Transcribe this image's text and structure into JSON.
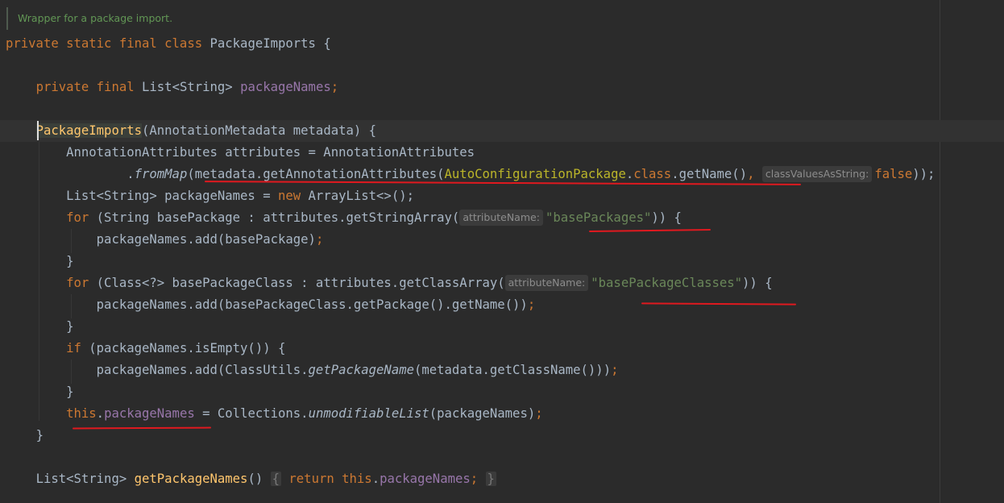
{
  "doc_comment": "Wrapper for a package import.",
  "code": {
    "class_decl": {
      "kw": "private static final class",
      "name": "PackageImports",
      "open": " {"
    },
    "field_decl": {
      "kw": "private final",
      "type": " List<String> ",
      "name": "packageNames",
      "end": ";"
    },
    "ctor": {
      "name": "PackageImports",
      "params": "(AnnotationMetadata metadata) {"
    },
    "l_attrs": "AnnotationAttributes attributes = AnnotationAttributes",
    "l_frommap": {
      "dot": ".",
      "method": "fromMap",
      "pre": "(metadata.getAnnotationAttributes(",
      "annotation": "AutoConfigurationPackage",
      "dot2": ".",
      "class_kw": "class",
      "post": ".getName()",
      "comma": ",",
      "hint": "classValuesAsString:",
      "value": "false",
      "end": "));"
    },
    "l_list": {
      "pre": "List<String> packageNames = ",
      "new_kw": "new",
      "post": " ArrayList<>();"
    },
    "l_for1": {
      "kw": "for",
      "pre": " (String basePackage : attributes.getStringArray(",
      "hint": "attributeName:",
      "str": "\"basePackages\"",
      "end": ")) {"
    },
    "l_add1": {
      "text": "packageNames.add(basePackage)",
      "end": ";"
    },
    "brace": "}",
    "l_for2": {
      "kw": "for",
      "pre": " (Class<?> basePackageClass : attributes.getClassArray(",
      "hint": "attributeName:",
      "str": "\"basePackageClasses\"",
      "end": ")) {"
    },
    "l_add2": {
      "text": "packageNames.add(basePackageClass.getPackage().getName())",
      "end": ";"
    },
    "l_if": {
      "kw": "if",
      "post": " (packageNames.isEmpty()) {"
    },
    "l_add3": {
      "pre": "packageNames.add(ClassUtils.",
      "method": "getPackageName",
      "post": "(metadata.getClassName()))",
      "end": ";"
    },
    "l_assign": {
      "this_kw": "this",
      "dot": ".",
      "field": "packageNames",
      "mid": " = Collections.",
      "method": "unmodifiableList",
      "post": "(packageNames)",
      "end": ";"
    },
    "l_getter": {
      "type": "List<String> ",
      "name": "getPackageNames",
      "paren": "()",
      "open": "{",
      "ret": "return",
      "this_kw": "this",
      "dot": ".",
      "field": "packageNames",
      "semi": ";",
      "close": "}"
    }
  },
  "colors": {
    "keyword": "#cc7832",
    "field": "#9876aa",
    "string": "#6a8759",
    "method": "#ffc66d",
    "annotation": "#bbb529",
    "underline": "#e0191f"
  }
}
